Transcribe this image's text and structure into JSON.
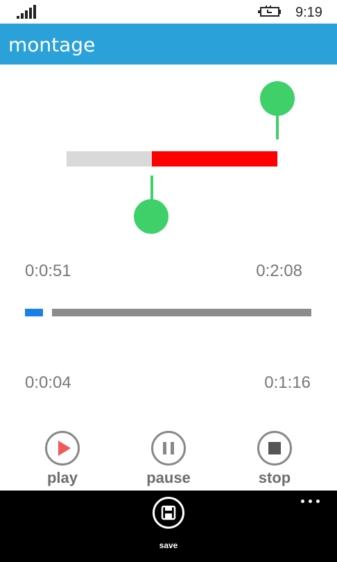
{
  "status": {
    "time": "9:19"
  },
  "app": {
    "title": "montage"
  },
  "trim": {
    "start_label": "0:0:51",
    "end_label": "0:2:08"
  },
  "playback": {
    "current_label": "0:0:04",
    "duration_label": "0:1:16",
    "progress_fraction": 0.07
  },
  "controls": {
    "play_label": "play",
    "pause_label": "pause",
    "stop_label": "stop"
  },
  "appbar": {
    "save_label": "save"
  },
  "colors": {
    "accent": "#2aa1d9",
    "trim_selected": "#ff0000",
    "handle": "#3fd06a",
    "progress": "#1a7fe8",
    "play_icon": "#f05a5a"
  },
  "icons": {
    "status": [
      "signal-icon",
      "battery-icon"
    ],
    "controls": [
      "play-icon",
      "pause-icon",
      "stop-icon"
    ],
    "appbar": [
      "save-icon",
      "more-icon"
    ]
  }
}
